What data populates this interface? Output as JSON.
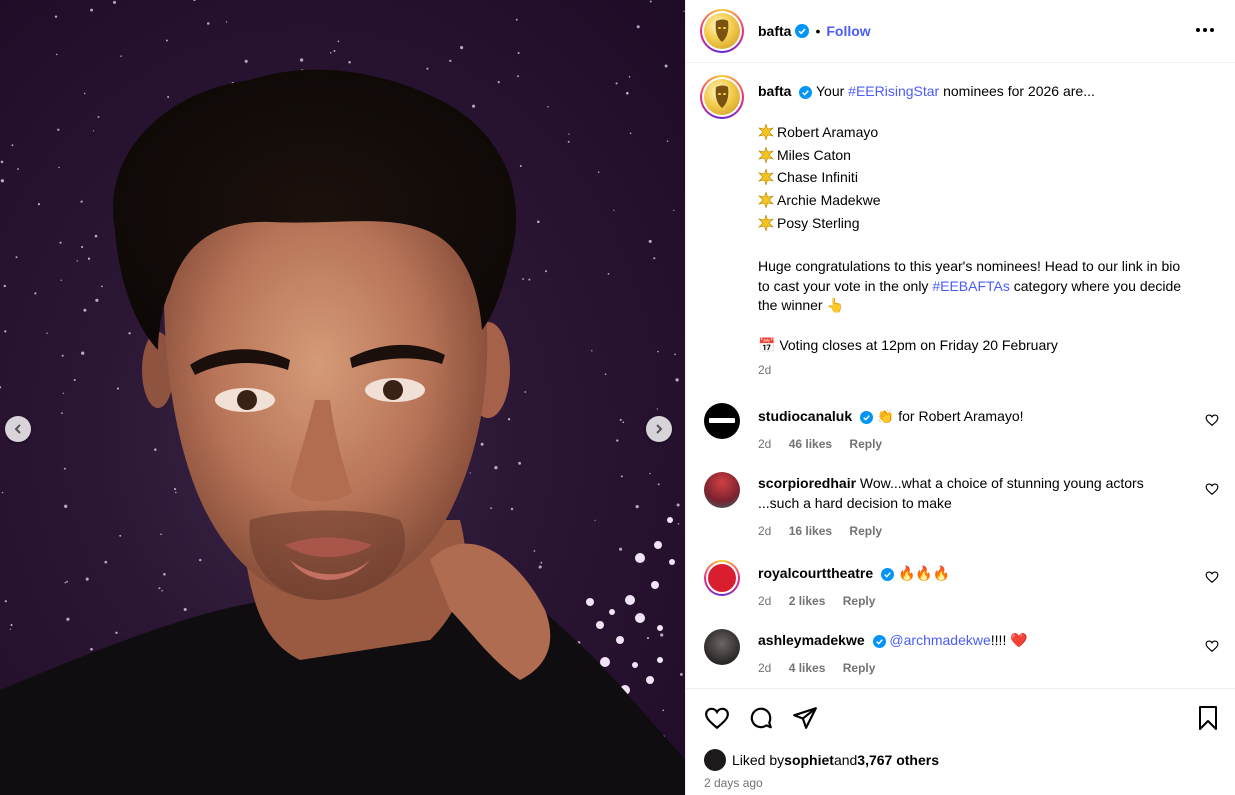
{
  "header": {
    "username": "bafta",
    "separator": "•",
    "follow_label": "Follow"
  },
  "caption": {
    "username": "bafta",
    "intro_pre": "Your ",
    "intro_hashtag": "#EERisingStar",
    "intro_post": " nominees for 2026 are...",
    "nominees": [
      "Robert Aramayo",
      "Miles Caton",
      "Chase Infiniti",
      "Archie Madekwe",
      "Posy Sterling"
    ],
    "body_1": "Huge congratulations to this year's nominees! Head to our link in bio to cast your vote in the only ",
    "body_hashtag": "#EEBAFTAs",
    "body_2": " category where you decide the winner ",
    "pointing_emoji": "👆",
    "calendar_emoji": "📅",
    "voting_line": "Voting closes at 12pm on Friday 20 February",
    "age": "2d"
  },
  "comments": [
    {
      "username": "studiocanaluk",
      "verified": true,
      "emoji": "👏",
      "text": " for Robert Aramayo!",
      "age": "2d",
      "likes": "46 likes",
      "reply": "Reply"
    },
    {
      "username": "scorpioredhair",
      "verified": false,
      "text": "Wow...what a choice of stunning young actors ...such a hard decision to make",
      "age": "2d",
      "likes": "16 likes",
      "reply": "Reply"
    },
    {
      "username": "royalcourttheatre",
      "verified": true,
      "text": "🔥🔥🔥",
      "age": "2d",
      "likes": "2 likes",
      "reply": "Reply"
    },
    {
      "username": "ashleymadekwe",
      "verified": true,
      "mention": "@archmadekwe",
      "text": "!!!! ❤️",
      "age": "2d",
      "likes": "4 likes",
      "reply": "Reply"
    }
  ],
  "footer": {
    "liked_by_pre": "Liked by ",
    "liked_by_user": "sophiet",
    "liked_by_mid": " and ",
    "liked_by_count": "3,767 others",
    "post_age": "2 days ago"
  },
  "icons": {
    "prev": "chevron-left-icon",
    "next": "chevron-right-icon",
    "more": "more-horizontal-icon",
    "like": "heart-icon",
    "comment": "comment-icon",
    "share": "share-icon",
    "save": "bookmark-icon",
    "verified": "verified-badge-icon"
  },
  "colors": {
    "link": "#4a5df9",
    "verified": "#0095f6",
    "secondary_text": "#737373",
    "background_purple": "#2b1634"
  }
}
